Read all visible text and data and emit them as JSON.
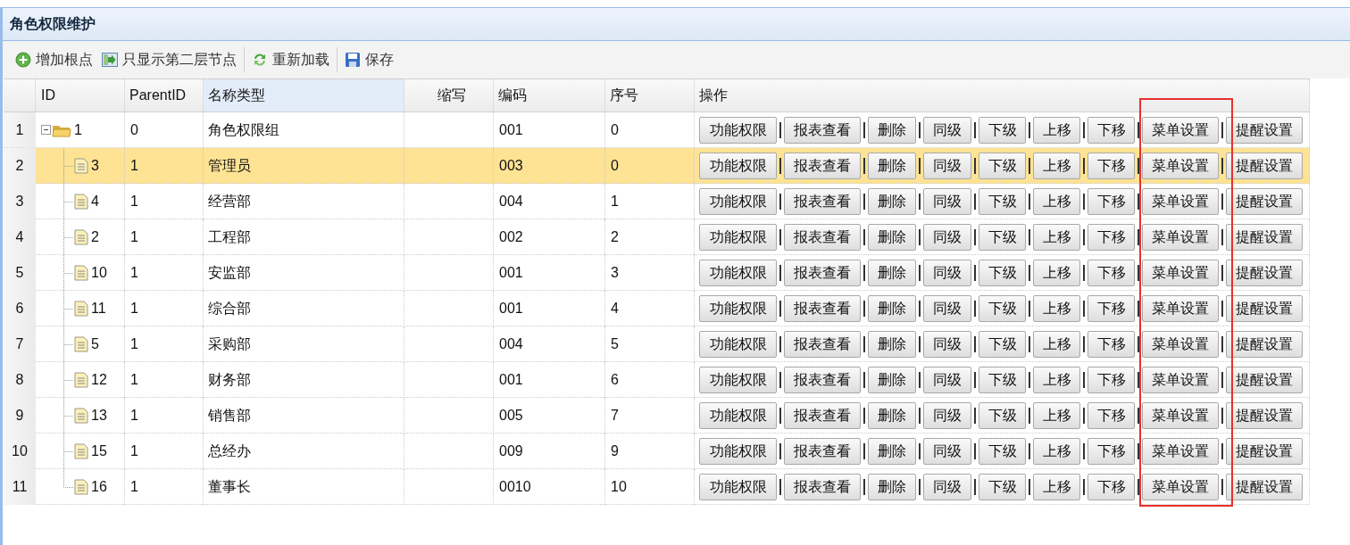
{
  "panel": {
    "title": "角色权限维护"
  },
  "toolbar": [
    {
      "kind": "add",
      "label": "增加根点"
    },
    {
      "kind": "level",
      "label": "只显示第二层节点"
    },
    {
      "kind": "reload",
      "label": "重新加载"
    },
    {
      "kind": "save",
      "label": "保存"
    }
  ],
  "table": {
    "columns": [
      {
        "label": "ID",
        "highlighted": false
      },
      {
        "label": "ParentID",
        "highlighted": false
      },
      {
        "label": "名称类型",
        "highlighted": true
      },
      {
        "label": "缩写",
        "highlighted": false
      },
      {
        "label": "编码",
        "highlighted": false
      },
      {
        "label": "序号",
        "highlighted": false
      },
      {
        "label": "操作",
        "highlighted": false
      }
    ],
    "framed_actions": [
      false,
      false,
      false,
      false,
      false,
      false,
      false,
      true,
      false
    ],
    "frame": {
      "color": "#e8302e"
    },
    "rows": [
      {
        "row_number": "1",
        "id": "1",
        "parent_id": "0",
        "name": "角色权限组",
        "code": "001",
        "order": "0",
        "expanded": true,
        "selected": false,
        "actions": [
          "功能权限",
          "报表查看",
          "删除",
          "同级",
          "下级",
          "上移",
          "下移",
          "菜单设置",
          "提醒设置"
        ],
        "children": [
          {
            "row_number": "2",
            "id": "3",
            "parent_id": "1",
            "name": "管理员",
            "code": "003",
            "order": "0",
            "selected": true,
            "actions": [
              "功能权限",
              "报表查看",
              "删除",
              "同级",
              "下级",
              "上移",
              "下移",
              "菜单设置",
              "提醒设置"
            ]
          },
          {
            "row_number": "3",
            "id": "4",
            "parent_id": "1",
            "name": "经营部",
            "code": "004",
            "order": "1",
            "selected": false,
            "actions": [
              "功能权限",
              "报表查看",
              "删除",
              "同级",
              "下级",
              "上移",
              "下移",
              "菜单设置",
              "提醒设置"
            ]
          },
          {
            "row_number": "4",
            "id": "2",
            "parent_id": "1",
            "name": "工程部",
            "code": "002",
            "order": "2",
            "selected": false,
            "actions": [
              "功能权限",
              "报表查看",
              "删除",
              "同级",
              "下级",
              "上移",
              "下移",
              "菜单设置",
              "提醒设置"
            ]
          },
          {
            "row_number": "5",
            "id": "10",
            "parent_id": "1",
            "name": "安监部",
            "code": "001",
            "order": "3",
            "selected": false,
            "actions": [
              "功能权限",
              "报表查看",
              "删除",
              "同级",
              "下级",
              "上移",
              "下移",
              "菜单设置",
              "提醒设置"
            ]
          },
          {
            "row_number": "6",
            "id": "11",
            "parent_id": "1",
            "name": "综合部",
            "code": "001",
            "order": "4",
            "selected": false,
            "actions": [
              "功能权限",
              "报表查看",
              "删除",
              "同级",
              "下级",
              "上移",
              "下移",
              "菜单设置",
              "提醒设置"
            ]
          },
          {
            "row_number": "7",
            "id": "5",
            "parent_id": "1",
            "name": "采购部",
            "code": "004",
            "order": "5",
            "selected": false,
            "actions": [
              "功能权限",
              "报表查看",
              "删除",
              "同级",
              "下级",
              "上移",
              "下移",
              "菜单设置",
              "提醒设置"
            ]
          },
          {
            "row_number": "8",
            "id": "12",
            "parent_id": "1",
            "name": "财务部",
            "code": "001",
            "order": "6",
            "selected": false,
            "actions": [
              "功能权限",
              "报表查看",
              "删除",
              "同级",
              "下级",
              "上移",
              "下移",
              "菜单设置",
              "提醒设置"
            ]
          },
          {
            "row_number": "9",
            "id": "13",
            "parent_id": "1",
            "name": "销售部",
            "code": "005",
            "order": "7",
            "selected": false,
            "actions": [
              "功能权限",
              "报表查看",
              "删除",
              "同级",
              "下级",
              "上移",
              "下移",
              "菜单设置",
              "提醒设置"
            ]
          },
          {
            "row_number": "10",
            "id": "15",
            "parent_id": "1",
            "name": "总经办",
            "code": "009",
            "order": "9",
            "selected": false,
            "actions": [
              "功能权限",
              "报表查看",
              "删除",
              "同级",
              "下级",
              "上移",
              "下移",
              "菜单设置",
              "提醒设置"
            ]
          },
          {
            "row_number": "11",
            "id": "16",
            "parent_id": "1",
            "name": "董事长",
            "code": "0010",
            "order": "10",
            "selected": false,
            "actions": [
              "功能权限",
              "报表查看",
              "删除",
              "同级",
              "下级",
              "上移",
              "下移",
              "菜单设置",
              "提醒设置"
            ]
          }
        ]
      }
    ]
  }
}
